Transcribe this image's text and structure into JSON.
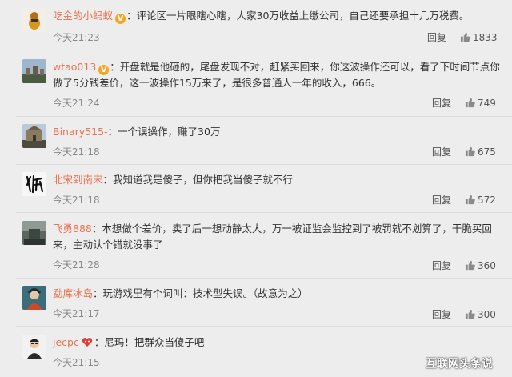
{
  "comments": [
    {
      "user": "吃金的小蚂蚁",
      "badge": "v",
      "text": "：评论区一片眼瞎心瞎，人家30万收益上缴公司，自己还要承担十几万税费。",
      "time": "今天21:23",
      "reply": "回复",
      "likes": "1833"
    },
    {
      "user": "wtao013",
      "badge": "v",
      "text": "：开盘就是他砸的，尾盘发现不对，赶紧买回来，你这波操作还可以，看了下时间节点你做了5分钱差价，这一波操作15万来了，是很多普通人一年的收入，666。",
      "time": "今天21:24",
      "reply": "回复",
      "likes": "749"
    },
    {
      "user": "Binary515-",
      "text": "：一个误操作，赚了30万",
      "time": "今天21:18",
      "reply": "回复",
      "likes": "675"
    },
    {
      "user": "北宋到南宋",
      "text": "：我知道我是傻子，但你把我当傻子就不行",
      "time": "今天21:18",
      "reply": "回复",
      "likes": "572"
    },
    {
      "user": "飞勇888",
      "text": "：本想做个差价，卖了后一想动静太大，万一被证监会监控到了被罚就不划算了，干脆买回来，主动认个错就没事了",
      "time": "今天21:28",
      "reply": "回复",
      "likes": "360"
    },
    {
      "user": "勐库冰岛",
      "text": "：玩游戏里有个词叫：技术型失误。（故意为之）",
      "time": "今天21:17",
      "reply": "回复",
      "likes": "300"
    },
    {
      "user": "jecpc",
      "badge": "heart",
      "text": "：尼玛！把群众当傻子吧",
      "time": "今天21:15",
      "reply": "",
      "likes": ""
    }
  ],
  "watermark": "互联网头条说",
  "colors": {
    "username": "#eb7350",
    "vip_badge": "#f5a623",
    "background": "#ededed"
  }
}
